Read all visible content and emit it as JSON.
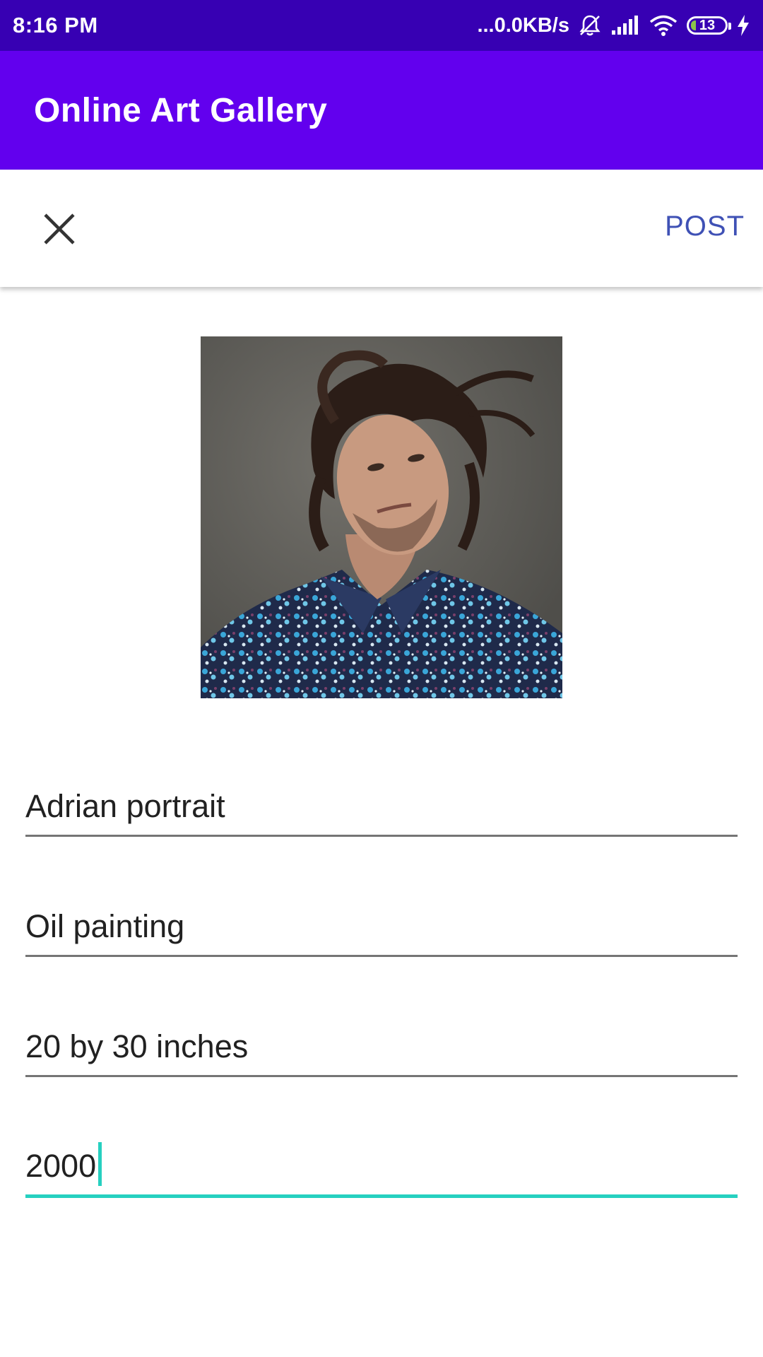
{
  "status_bar": {
    "time": "8:16 PM",
    "network_speed": "...0.0KB/s",
    "battery_level": "13",
    "icons": [
      "silent-icon",
      "signal-icon",
      "wifi-icon",
      "battery-icon",
      "charging-icon"
    ]
  },
  "app_bar": {
    "title": "Online Art Gallery",
    "color": "#6200ee"
  },
  "toolbar": {
    "close_icon": "close-icon",
    "post_label": "POST",
    "post_color": "#3f51b5"
  },
  "artwork": {
    "image": "portrait-photo"
  },
  "form": {
    "fields": [
      {
        "value": "Adrian portrait"
      },
      {
        "value": "Oil painting"
      },
      {
        "value": "20 by 30 inches"
      },
      {
        "value": "2000",
        "focused": true
      }
    ],
    "accent_color": "#26d0c0"
  }
}
